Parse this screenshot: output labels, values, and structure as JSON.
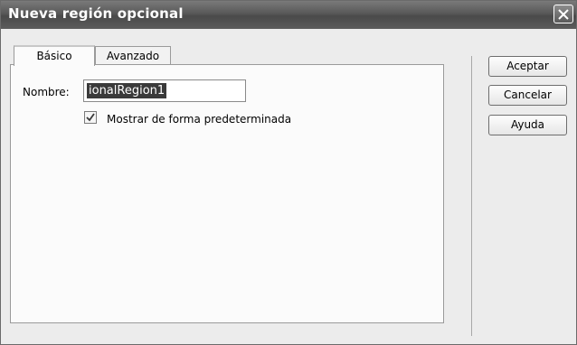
{
  "dialog": {
    "title": "Nueva región opcional",
    "close_icon": "close-icon"
  },
  "tabs": [
    {
      "label": "Básico",
      "active": true
    },
    {
      "label": "Avanzado",
      "active": false
    }
  ],
  "basic": {
    "name_label": "Nombre:",
    "name_value": "ionalRegion1",
    "show_default_label": "Mostrar de forma predeterminada",
    "show_default_checked": true
  },
  "buttons": {
    "ok": "Aceptar",
    "cancel": "Cancelar",
    "help": "Ayuda"
  }
}
